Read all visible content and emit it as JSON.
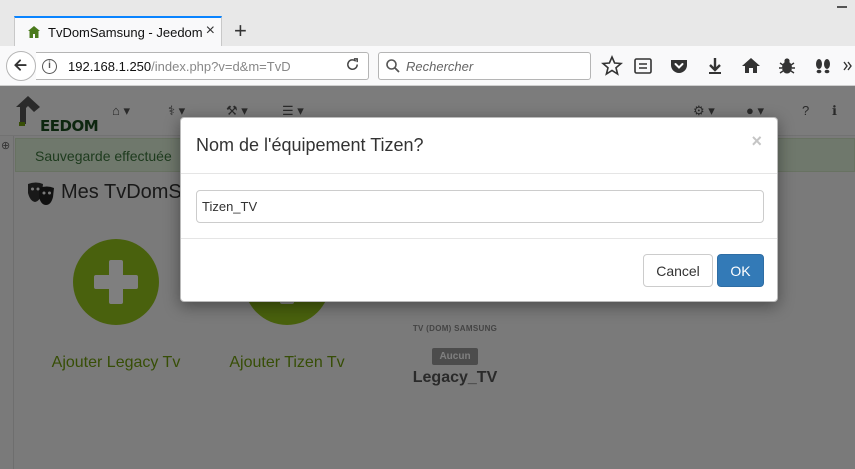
{
  "browser": {
    "tab_title": "TvDomSamsung - Jeedom",
    "url_host": "192.168.1.250",
    "url_path": "/index.php?v=d&m=TvD",
    "search_placeholder": "Rechercher",
    "toolbar_icons": [
      "bookmark-star-icon",
      "reading-list-icon",
      "pocket-icon",
      "download-icon",
      "home-icon",
      "bug-icon",
      "footprint-icon"
    ]
  },
  "app": {
    "logo_text": "EEDOM",
    "alert_text": "Sauvegarde effectuée",
    "page_title": "Mes TvDomS",
    "cards": [
      {
        "label": "Ajouter Legacy Tv"
      },
      {
        "label": "Ajouter Tizen Tv"
      }
    ],
    "device": {
      "category": "TV (DOM) SAMSUNG",
      "badge": "Aucun",
      "name": "Legacy_TV"
    }
  },
  "modal": {
    "title": "Nom de l'équipement Tizen?",
    "close": "×",
    "input_value": "Tizen_TV",
    "cancel_label": "Cancel",
    "ok_label": "OK"
  },
  "colors": {
    "accent_green": "#93c21b",
    "label_green": "#6e9c0c",
    "primary_blue": "#337ab7",
    "alert_bg": "#dff0d8"
  }
}
